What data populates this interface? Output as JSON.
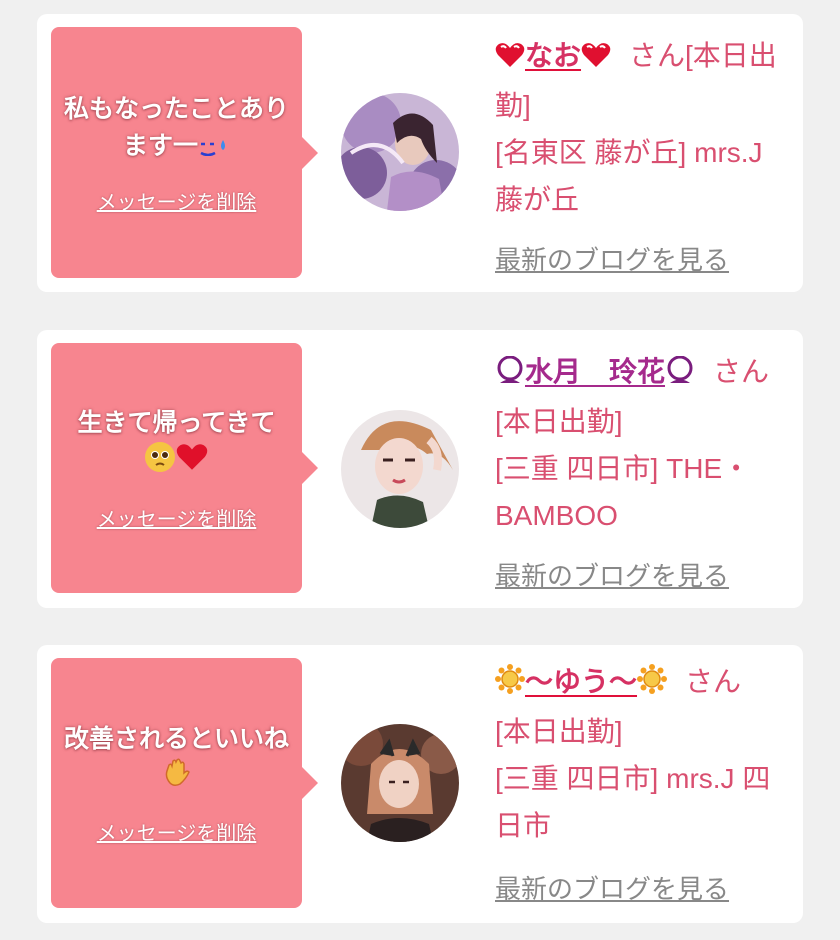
{
  "actions": {
    "delete_message": "メッセージを削除",
    "view_blog": "最新のブログを見る"
  },
  "items": [
    {
      "comment": "私もなったことあります一",
      "comment_emoji": "sweat-smile-icon",
      "name": "なお",
      "name_icon": "heart-icon",
      "honorific": "さん",
      "status": "[本日出勤]",
      "location": "[名東区 藤が丘] mrs.J 藤が丘"
    },
    {
      "comment": "生きて帰ってきて",
      "comment_emoji": "pleading-face-icon heart-icon",
      "name": "水月　玲花",
      "name_icon": "crystal-ball-icon",
      "honorific": "さん",
      "status": "[本日出勤]",
      "location": "[三重 四日市] THE・BAMBOO"
    },
    {
      "comment": "改善されるといいね",
      "comment_emoji": "waving-hand-icon",
      "name": "〜ゆう〜",
      "name_icon": "sun-flower-icon",
      "honorific": "さん",
      "status": "[本日出勤]",
      "location": "[三重 四日市] mrs.J 四日市"
    }
  ],
  "colors": {
    "bubble": "#f7858f",
    "info_text": "#d94f70",
    "name_text": "#d63163",
    "name_purple": "#a52a8c",
    "link_gray": "#888888",
    "page_bg": "#f0f0f0",
    "card_bg": "#ffffff"
  }
}
